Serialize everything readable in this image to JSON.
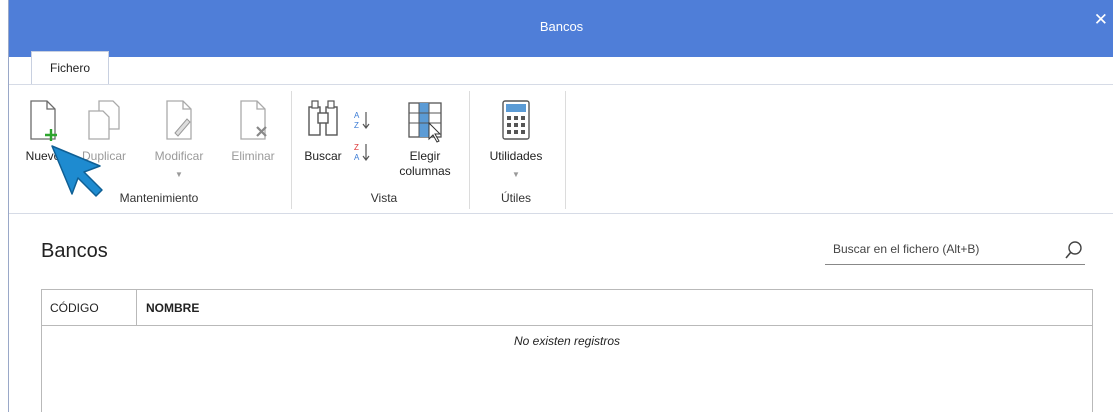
{
  "window": {
    "title": "Bancos",
    "close_symbol": "✕"
  },
  "ribbon": {
    "tab_label": "Fichero",
    "groups": [
      {
        "label": "Mantenimiento",
        "buttons": [
          {
            "label": "Nuevo",
            "icon": "new-document-icon",
            "enabled": true
          },
          {
            "label": "Duplicar",
            "icon": "duplicate-document-icon",
            "enabled": false
          },
          {
            "label": "Modificar",
            "icon": "edit-document-icon",
            "enabled": false,
            "dropdown": true
          },
          {
            "label": "Eliminar",
            "icon": "delete-document-icon",
            "enabled": false
          }
        ]
      },
      {
        "label": "Vista",
        "buttons": [
          {
            "label": "Buscar",
            "icon": "binoculars-icon",
            "enabled": true
          },
          {
            "label": "Elegir columnas",
            "icon": "choose-columns-icon",
            "enabled": true
          },
          {
            "label": "",
            "icon": "sort-ascending-icon",
            "enabled": true
          },
          {
            "label": "",
            "icon": "sort-descending-icon",
            "enabled": true
          }
        ]
      },
      {
        "label": "Útiles",
        "buttons": [
          {
            "label": "Utilidades",
            "icon": "calculator-icon",
            "enabled": true,
            "dropdown": true
          }
        ]
      }
    ]
  },
  "main": {
    "title": "Bancos",
    "search_placeholder": "Buscar en el fichero (Alt+B)",
    "table": {
      "columns": [
        "CÓDIGO",
        "NOMBRE"
      ],
      "empty_message": "No existen registros"
    }
  },
  "colors": {
    "titlebar": "#4f7ed8",
    "accent_arrow": "#1e8bd0",
    "new_plus": "#2da52d"
  }
}
